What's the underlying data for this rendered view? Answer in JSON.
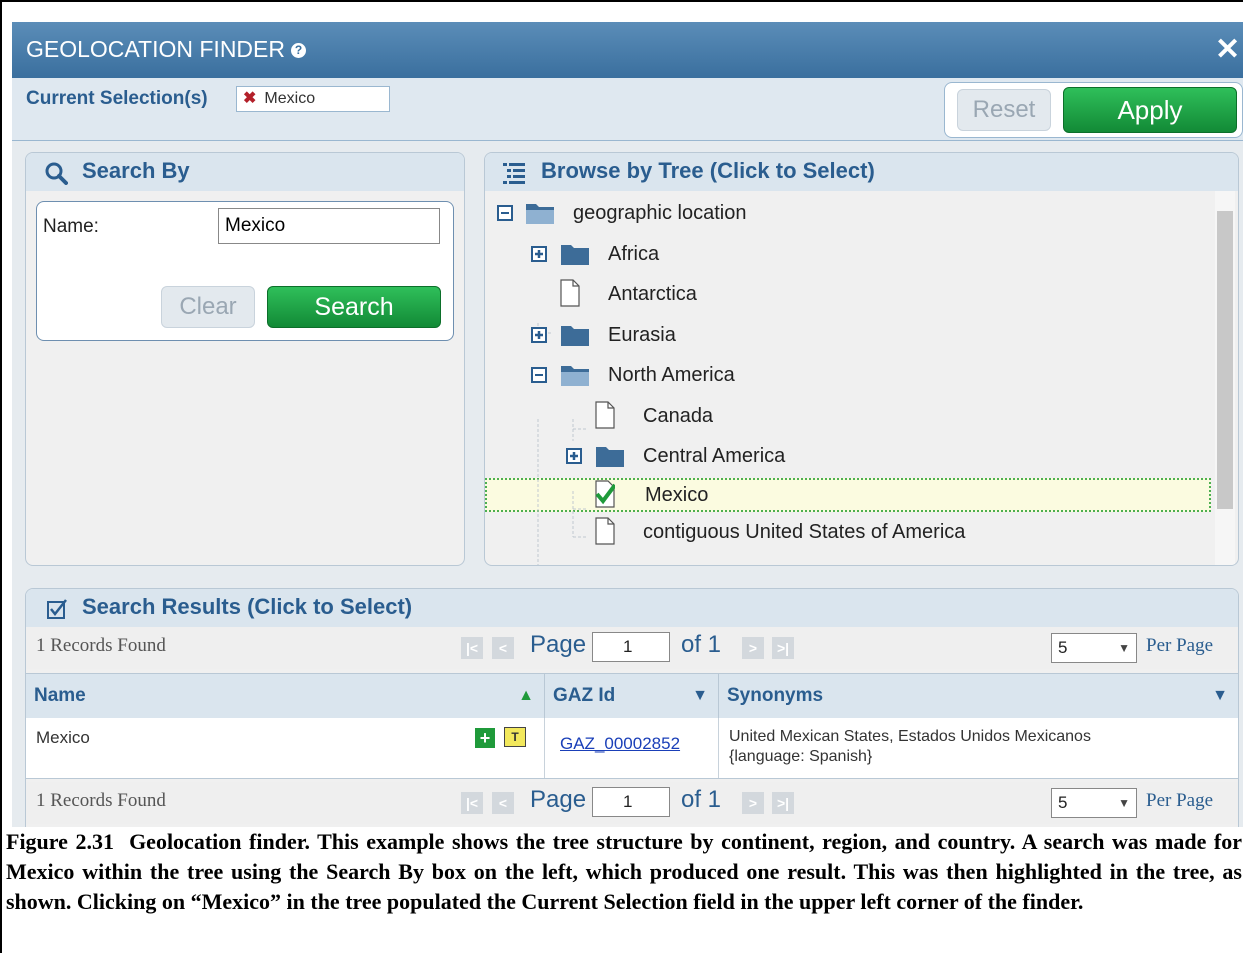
{
  "dialog": {
    "title": "GEOLOCATION FINDER",
    "help_glyph": "?",
    "close_glyph": "✕"
  },
  "selection": {
    "label": "Current Selection(s)",
    "chip_remove_glyph": "✖",
    "chip_value": "Mexico",
    "reset_label": "Reset",
    "apply_label": "Apply"
  },
  "search": {
    "heading": "Search By",
    "name_label": "Name:",
    "name_value": "Mexico",
    "clear_label": "Clear",
    "search_label": "Search"
  },
  "tree": {
    "heading": "Browse by Tree (Click to Select)",
    "nodes": [
      {
        "label": "geographic location",
        "icon": "folder-open-icon",
        "toggle": "minus"
      },
      {
        "label": "Africa",
        "icon": "folder-icon",
        "toggle": "plus"
      },
      {
        "label": "Antarctica",
        "icon": "document-icon",
        "toggle": "none"
      },
      {
        "label": "Eurasia",
        "icon": "folder-icon",
        "toggle": "plus"
      },
      {
        "label": "North America",
        "icon": "folder-open-icon",
        "toggle": "minus"
      },
      {
        "label": "Canada",
        "icon": "document-icon",
        "toggle": "none"
      },
      {
        "label": "Central America",
        "icon": "folder-icon",
        "toggle": "plus"
      },
      {
        "label": "Mexico",
        "icon": "checked-document-icon",
        "toggle": "none",
        "selected": true
      },
      {
        "label": "contiguous United States of America",
        "icon": "document-icon",
        "toggle": "none"
      }
    ]
  },
  "results": {
    "heading": "Search Results (Click to Select)",
    "records_found": "1 Records Found",
    "page_label": "Page",
    "page_value": "1",
    "of_label": "of 1",
    "per_page_value": "5",
    "per_page_label": "Per Page",
    "columns": [
      "Name",
      "GAZ Id",
      "Synonyms"
    ],
    "rows": [
      {
        "name": "Mexico",
        "gaz_id": "GAZ_00002852",
        "synonyms_line1": "United Mexican States, Estados Unidos Mexicanos",
        "synonyms_line2": "{language: Spanish}"
      }
    ]
  },
  "caption": {
    "label": "Figure 2.31",
    "text": "Geolocation finder.  This example shows the tree structure by continent, region, and country.  A search was made for Mexico within the tree using the Search By box on the left, which produced one result.  This was then highlighted in the tree, as shown.  Clicking on “Mexico” in the tree populated the Current Selection field in the upper left corner of the finder."
  },
  "colors": {
    "title_bar": "#3a6f9e",
    "heading_text": "#2a5d8f",
    "apply_green": "#1f9a3a",
    "folder_blue": "#3d6c98",
    "highlight": "#fbfbe0"
  }
}
